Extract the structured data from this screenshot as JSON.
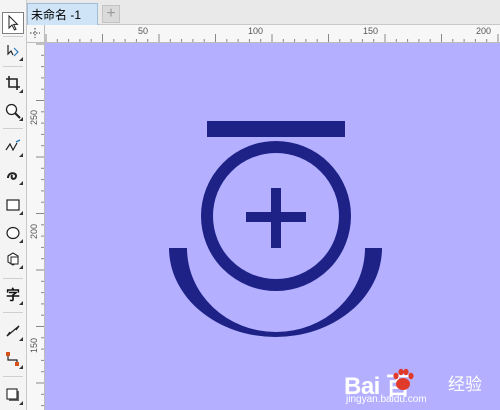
{
  "document": {
    "tab_title": "未命名 -1",
    "new_tab_symbol": "+"
  },
  "toolbox": {
    "tools": [
      {
        "name": "pick-tool",
        "icon": "cursor-arrow-icon",
        "active": true
      },
      {
        "name": "shape-tool",
        "icon": "shape-node-icon"
      },
      {
        "name": "crop-tool",
        "icon": "crop-icon"
      },
      {
        "name": "zoom-tool",
        "icon": "magnifier-icon"
      },
      {
        "name": "freehand-tool",
        "icon": "freehand-line-icon"
      },
      {
        "name": "artistic-media-tool",
        "icon": "spiral-brush-icon"
      },
      {
        "name": "rectangle-tool",
        "icon": "rectangle-icon"
      },
      {
        "name": "ellipse-tool",
        "icon": "ellipse-icon"
      },
      {
        "name": "polygon-tool",
        "icon": "polygon-icon"
      },
      {
        "name": "text-tool",
        "icon": "text-char-icon",
        "label": "字"
      },
      {
        "name": "dimension-tool",
        "icon": "dimension-line-icon"
      },
      {
        "name": "connector-tool",
        "icon": "connector-icon"
      },
      {
        "name": "drop-shadow-tool",
        "icon": "drop-shadow-icon"
      }
    ]
  },
  "rulers": {
    "horizontal_labels": [
      "50",
      "100",
      "150",
      "200"
    ],
    "vertical_labels": [
      "250",
      "200",
      "150"
    ]
  },
  "canvas": {
    "background_color": "#b4b0ff",
    "shape_color": "#1e2287",
    "drawing_icon": "plus-circle-with-bar-and-arc-icon"
  },
  "watermark": {
    "brand": "Bai  百",
    "suffix": "经验",
    "url": "jingyan.baidu.com",
    "icon": "paw-icon"
  }
}
